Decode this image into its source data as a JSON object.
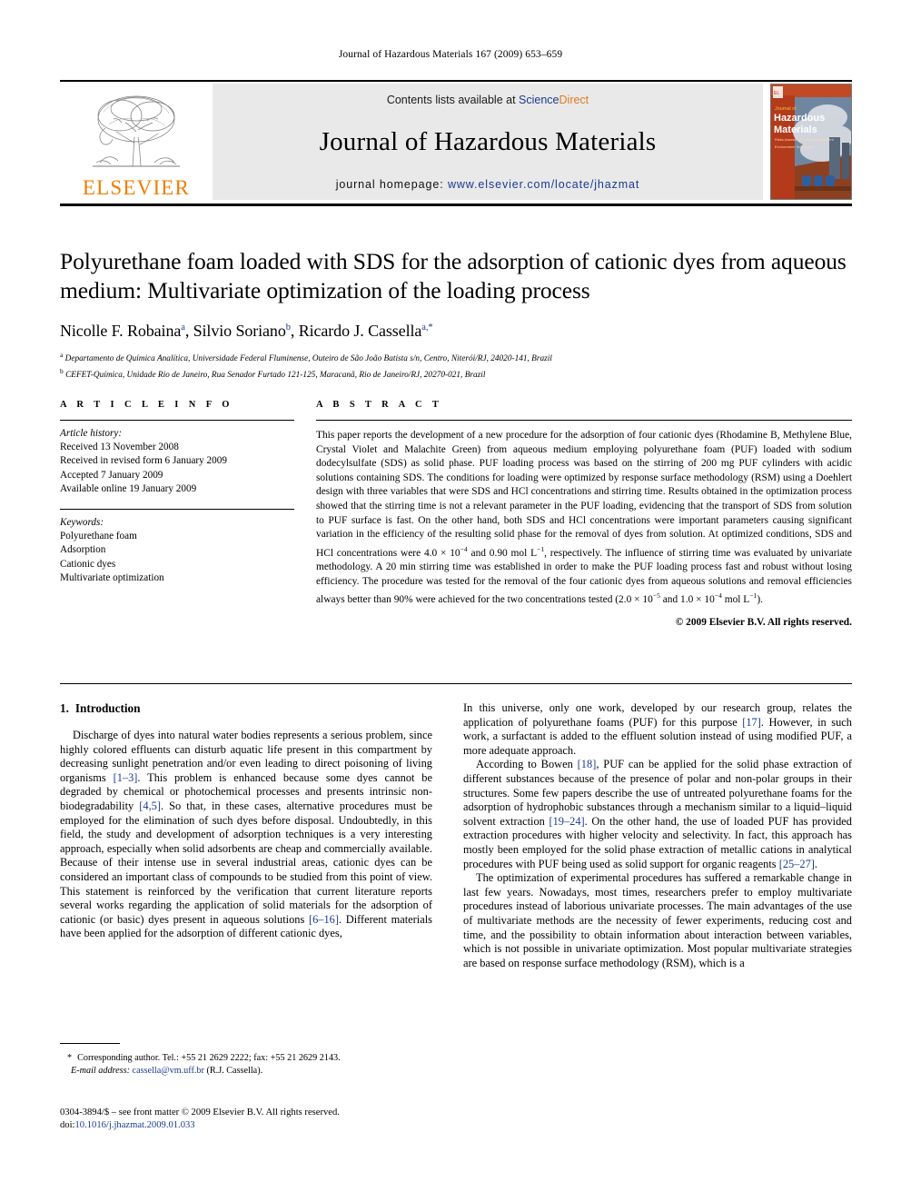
{
  "running_head": "Journal of Hazardous Materials 167 (2009) 653–659",
  "masthead": {
    "publisher_name": "ELSEVIER",
    "contents_prefix": "Contents lists available at ",
    "contents_link_part1": "Science",
    "contents_link_part2": "Direct",
    "journal_title": "Journal of Hazardous Materials",
    "homepage_label": "journal homepage:",
    "homepage_url": "www.elsevier.com/locate/jhazmat",
    "cover_line1": "Journal of",
    "cover_line2": "Hazardous",
    "cover_line3": "Materials",
    "cover_sub1": "Risks Assessment and Management",
    "cover_sub2": "Environment Solutions"
  },
  "article": {
    "title": "Polyurethane foam loaded with SDS for the adsorption of cationic dyes from aqueous medium: Multivariate optimization of the loading process",
    "authors": [
      {
        "name": "Nicolle F. Robaina",
        "sup": "a"
      },
      {
        "name": "Silvio Soriano",
        "sup": "b"
      },
      {
        "name": "Ricardo J. Cassella",
        "sup": "a,*"
      }
    ],
    "affiliations": [
      {
        "mark": "a",
        "text": "Departamento de Química Analítica, Universidade Federal Fluminense, Outeiro de São João Batista s/n, Centro, Niterói/RJ, 24020-141, Brazil"
      },
      {
        "mark": "b",
        "text": "CEFET-Química, Unidade Rio de Janeiro, Rua Senador Furtado 121-125, Maracanã, Rio de Janeiro/RJ, 20270-021, Brazil"
      }
    ]
  },
  "article_info": {
    "heading": "A R T I C L E   I N F O",
    "history_label": "Article history:",
    "history": [
      "Received 13 November 2008",
      "Received in revised form 6 January 2009",
      "Accepted 7 January 2009",
      "Available online 19 January 2009"
    ],
    "keywords_label": "Keywords:",
    "keywords": [
      "Polyurethane foam",
      "Adsorption",
      "Cationic dyes",
      "Multivariate optimization"
    ]
  },
  "abstract": {
    "heading": "A B S T R A C T",
    "paragraph_part1": "This paper reports the development of a new procedure for the adsorption of four cationic dyes (Rhodamine B, Methylene Blue, Crystal Violet and Malachite Green) from aqueous medium employing polyurethane foam (PUF) loaded with sodium dodecylsulfate (SDS) as solid phase. PUF loading process was based on the stirring of 200 mg PUF cylinders with acidic solutions containing SDS. The conditions for loading were optimized by response surface methodology (RSM) using a Doehlert design with three variables that were SDS and HCl concentrations and stirring time. Results obtained in the optimization process showed that the stirring time is not a relevant parameter in the PUF loading, evidencing that the transport of SDS from solution to PUF surface is fast. On the other hand, both SDS and HCl concentrations were important parameters causing significant variation in the efficiency of the resulting solid phase for the removal of dyes from solution. At optimized conditions, SDS and HCl concentrations were 4.0 × 10",
    "exp1": "−4",
    "paragraph_part2": " and 0.90 mol L",
    "exp2": "−1",
    "paragraph_part3": ", respectively. The influence of stirring time was evaluated by univariate methodology. A 20 min stirring time was established in order to make the PUF loading process fast and robust without losing efficiency. The procedure was tested for the removal of the four cationic dyes from aqueous solutions and removal efficiencies always better than 90% were achieved for the two concentrations tested (2.0 × 10",
    "exp3": "−5",
    "paragraph_part4": " and 1.0 × 10",
    "exp4": "−4",
    "paragraph_part5": " mol L",
    "exp5": "−1",
    "paragraph_part6": ").",
    "copyright": "© 2009 Elsevier B.V. All rights reserved."
  },
  "body": {
    "section_number": "1.",
    "section_title": "Introduction",
    "left_paragraphs": [
      {
        "segments": [
          {
            "t": "Discharge of dyes into natural water bodies represents a serious problem, since highly colored effluents can disturb aquatic life present in this compartment by decreasing sunlight penetration and/or even leading to direct poisoning of living organisms "
          },
          {
            "t": "[1–3]",
            "ref": true
          },
          {
            "t": ". This problem is enhanced because some dyes cannot be degraded by chemical or photochemical processes and presents intrinsic non-biodegradability "
          },
          {
            "t": "[4,5]",
            "ref": true
          },
          {
            "t": ". So that, in these cases, alternative procedures must be employed for the elimination of such dyes before disposal. Undoubtedly, in this field, the study and development of adsorption techniques is a very interesting approach, especially when solid adsorbents are cheap and commercially available. Because of their intense use in several industrial areas, cationic dyes can be considered an important class of compounds to be studied from this point of view. This statement is reinforced by the verification that current literature reports several works regarding the application of solid materials for the adsorption of cationic (or basic) dyes present in aqueous solutions "
          },
          {
            "t": "[6–16]",
            "ref": true
          },
          {
            "t": ". Different materials have been applied for the adsorption of different cationic dyes,"
          }
        ]
      }
    ],
    "right_paragraphs": [
      {
        "no_indent": true,
        "segments": [
          {
            "t": "In this universe, only one work, developed by our research group, relates the application of polyurethane foams (PUF) for this purpose "
          },
          {
            "t": "[17]",
            "ref": true
          },
          {
            "t": ". However, in such work, a surfactant is added to the effluent solution instead of using modified PUF, a more adequate approach."
          }
        ]
      },
      {
        "segments": [
          {
            "t": "According to Bowen "
          },
          {
            "t": "[18]",
            "ref": true
          },
          {
            "t": ", PUF can be applied for the solid phase extraction of different substances because of the presence of polar and non-polar groups in their structures. Some few papers describe the use of untreated polyurethane foams for the adsorption of hydrophobic substances through a mechanism similar to a liquid–liquid solvent extraction "
          },
          {
            "t": "[19–24]",
            "ref": true
          },
          {
            "t": ". On the other hand, the use of loaded PUF has provided extraction procedures with higher velocity and selectivity. In fact, this approach has mostly been employed for the solid phase extraction of metallic cations in analytical procedures with PUF being used as solid support for organic reagents "
          },
          {
            "t": "[25–27]",
            "ref": true
          },
          {
            "t": "."
          }
        ]
      },
      {
        "segments": [
          {
            "t": "The optimization of experimental procedures has suffered a remarkable change in last few years. Nowadays, most times, researchers prefer to employ multivariate procedures instead of laborious univariate processes. The main advantages of the use of multivariate methods are the necessity of fewer experiments, reducing cost and time, and the possibility to obtain information about interaction between variables, which is not possible in univariate optimization. Most popular multivariate strategies are based on response surface methodology (RSM), which is a"
          }
        ]
      }
    ]
  },
  "footnote": {
    "star": "*",
    "corresponding": "Corresponding author. Tel.: +55 21 2629 2222; fax: +55 21 2629 2143.",
    "email_label": "E-mail address:",
    "email": "cassella@vm.uff.br",
    "email_suffix": "(R.J. Cassella)."
  },
  "imprint": {
    "issn_line": "0304-3894/$ – see front matter © 2009 Elsevier B.V. All rights reserved.",
    "doi_label": "doi:",
    "doi": "10.1016/j.jhazmat.2009.01.033"
  },
  "colors": {
    "link": "#1a3a8f",
    "elsevier_orange": "#f07d00",
    "masthead_grey": "#e9e9ea"
  }
}
